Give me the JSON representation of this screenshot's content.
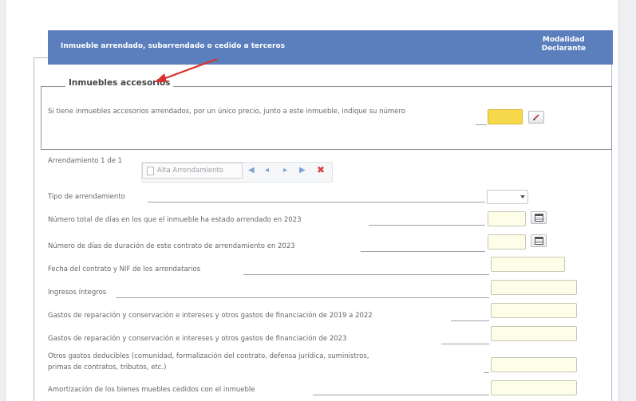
{
  "header": {
    "title": "Inmueble arrendado, subarrendado o cedido a terceros",
    "mode_line1": "Modalidad",
    "mode_line2": "Declarante"
  },
  "accessory": {
    "legend": "Inmuebles accesorios",
    "question": "Si tiene inmuebles accesorios arrendados, por un único precio, junto a este inmueble, indique su número",
    "value": ""
  },
  "lease_nav": {
    "label": "Arrendamiento 1 de 1",
    "add_button": "Alta Arrendamiento",
    "icons": {
      "first": "◀",
      "prev": "◂",
      "next": "▸",
      "last": "▶",
      "delete": "✖"
    }
  },
  "fields": [
    {
      "label": "Tipo de arrendamiento",
      "value": ""
    },
    {
      "label": "Número total de días en los que el inmueble ha estado arrendado en 2023",
      "value": ""
    },
    {
      "label": "Número de días de duración de este contrato de arrendamiento en 2023",
      "value": ""
    },
    {
      "label": "Fecha del contrato y NIF de los arrendatarios",
      "value": ""
    },
    {
      "label": "Ingresos íntegros",
      "value": ""
    },
    {
      "label": "Gastos de reparación y conservación e intereses y otros gastos de financiación de 2019 a 2022",
      "value": ""
    },
    {
      "label": "Gastos de reparación y conservación e intereses y otros gastos de financiación de 2023",
      "value": ""
    },
    {
      "label_line1": "Otros gastos deducibles (comunidad, formalización del contrato, defensa jurídica, suministros,",
      "label_line2": "primas de contratos, tributos, etc.)",
      "value": ""
    },
    {
      "label": "Amortización de los bienes muebles cedidos con el inmueble",
      "value": ""
    }
  ],
  "colors": {
    "header_bg": "#5b7fbd",
    "required_input": "#f7d84a",
    "input_bg": "#fdfde8",
    "arrow": "#d9312b"
  }
}
